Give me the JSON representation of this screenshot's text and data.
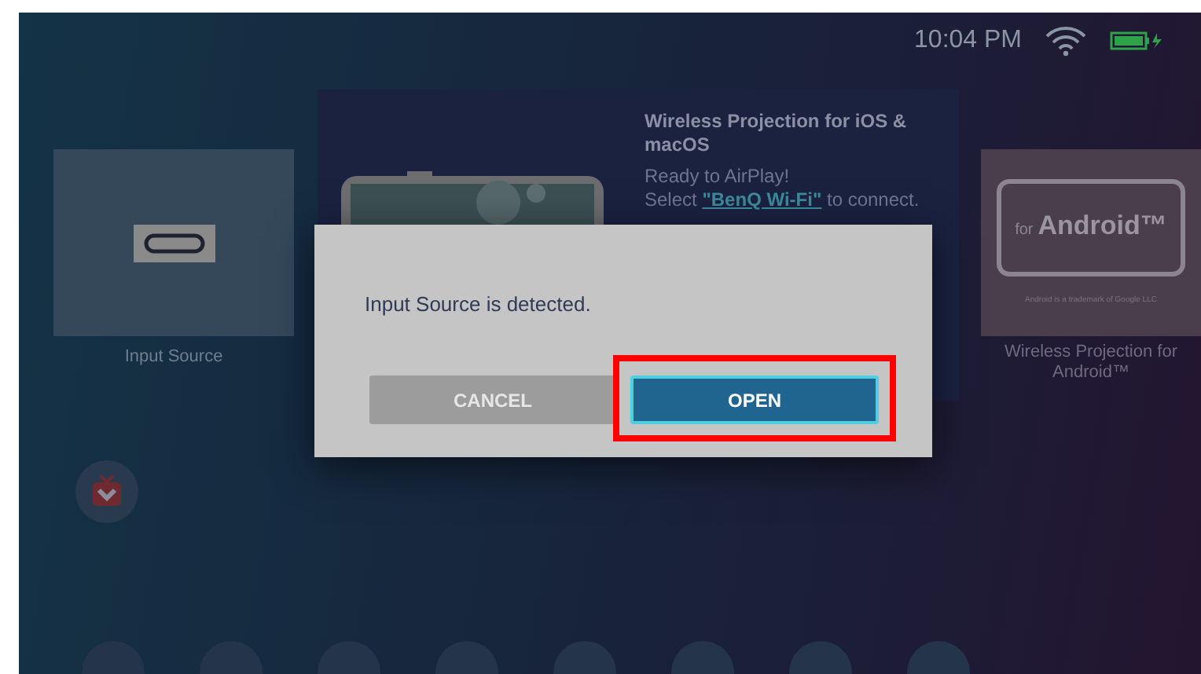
{
  "status_bar": {
    "time": "10:04 PM"
  },
  "tiles": [
    {
      "kind": "input",
      "label": "Input Source"
    },
    {
      "kind": "featured",
      "title": "Wireless Projection for iOS & macOS",
      "text": "Ready to AirPlay!",
      "link_prefix": "Select",
      "link": "\"BenQ Wi-Fi\"",
      "link_suffix": "to connect."
    },
    {
      "kind": "android",
      "badge_small": "for",
      "badge_large": "Android™",
      "note": "Android is a trademark of Google LLC",
      "label": "Wireless Projection for Android™"
    }
  ],
  "dialog": {
    "message": "Input Source is detected.",
    "buttons": [
      {
        "label": "CANCEL",
        "focused": false,
        "highlighted": false
      },
      {
        "label": "OPEN",
        "focused": true,
        "highlighted": true
      }
    ]
  }
}
